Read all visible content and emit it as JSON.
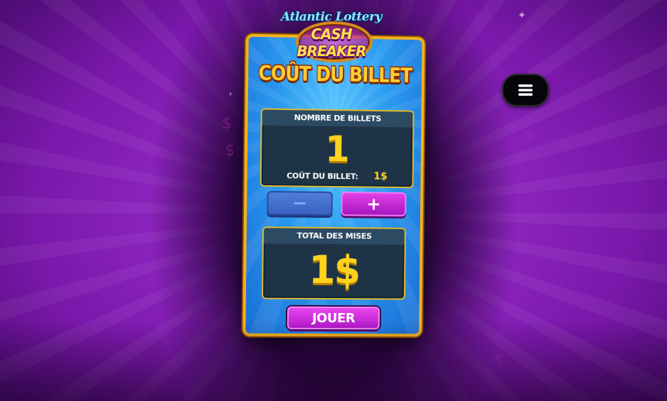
{
  "logo": {
    "top_text": "Atlantic Lottery",
    "main_text": "CASH BREAKER"
  },
  "menu": {
    "icon": "hamburger-icon"
  },
  "card": {
    "title": "COÛT DU BILLET",
    "tickets_panel": {
      "header": "NOMBRE DE BILLETS",
      "count": "1",
      "cost_label": "COÛT DU BILLET:",
      "cost_value": "1$"
    },
    "minus_label": "−",
    "plus_label": "+",
    "total_panel": {
      "header": "TOTAL DES MISES",
      "value": "1$"
    },
    "play_label": "JOUER"
  },
  "colors": {
    "background": "#7a18ab",
    "card_blue": "#2a9af0",
    "gold": "#ffd21e",
    "magenta_button": "#c021d6",
    "panel_dark": "#1f3347"
  }
}
